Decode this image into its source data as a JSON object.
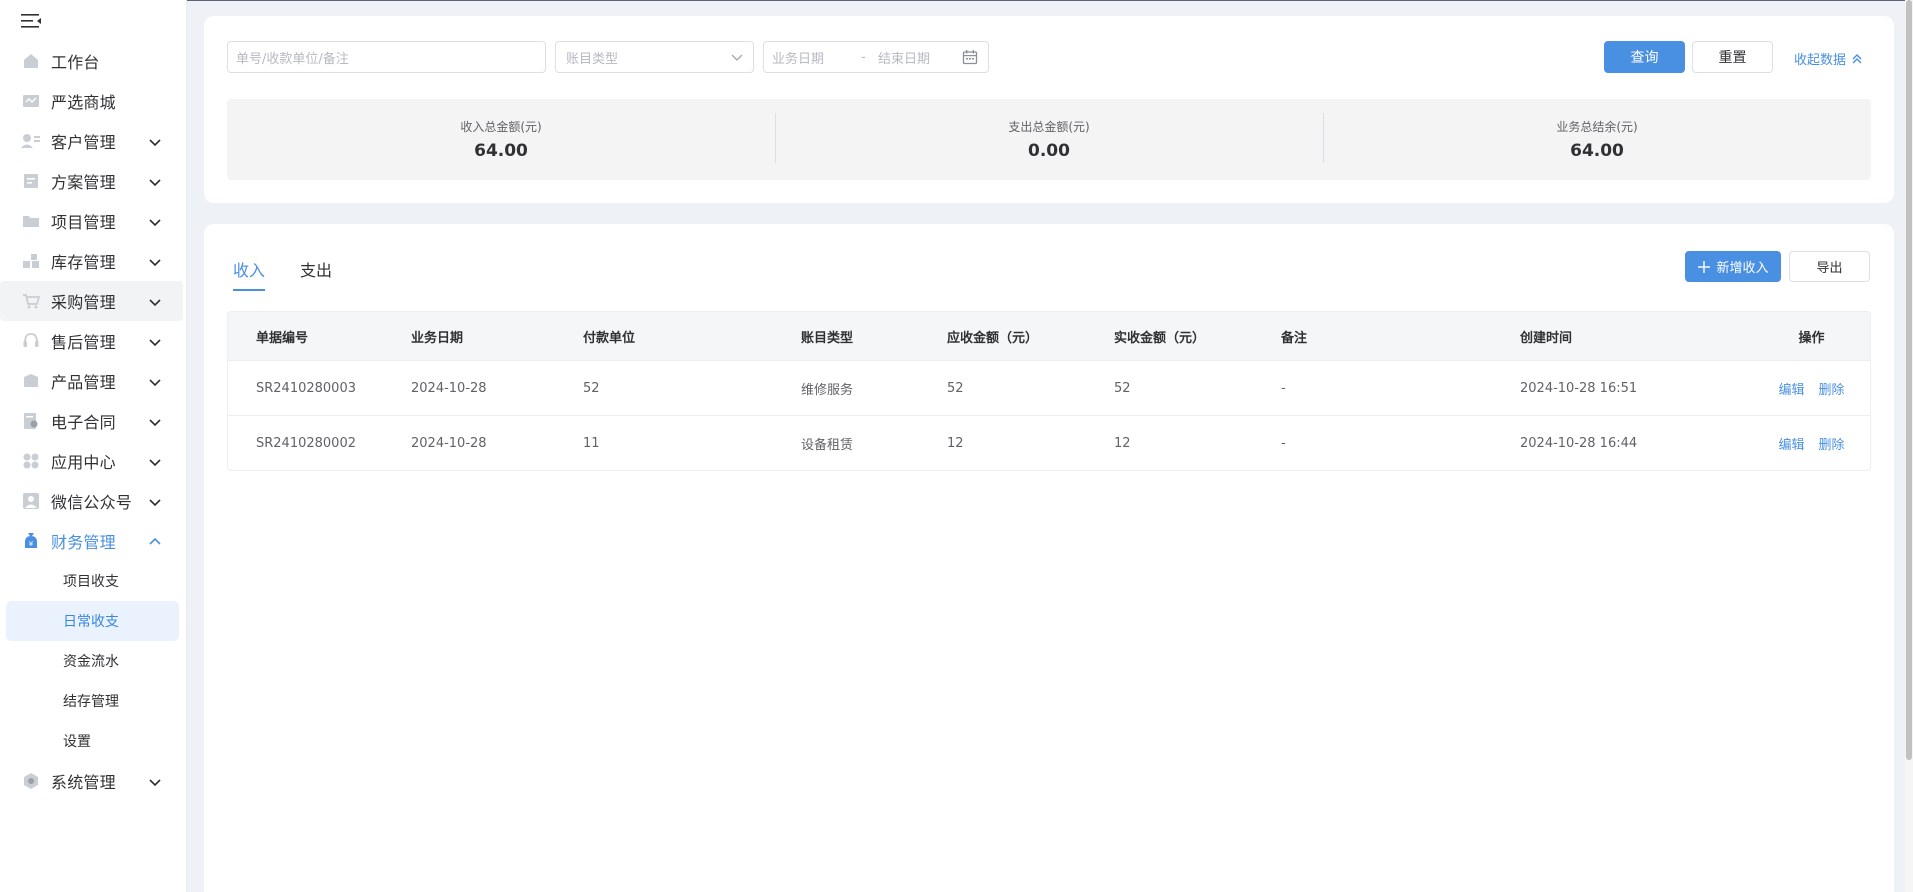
{
  "sidebar": {
    "items": [
      {
        "label": "工作台",
        "icon": "home-icon",
        "has_children": false
      },
      {
        "label": "严选商城",
        "icon": "mall-icon",
        "has_children": false
      },
      {
        "label": "客户管理",
        "icon": "customer-icon",
        "has_children": true
      },
      {
        "label": "方案管理",
        "icon": "plan-icon",
        "has_children": true
      },
      {
        "label": "项目管理",
        "icon": "folder-icon",
        "has_children": true
      },
      {
        "label": "库存管理",
        "icon": "inventory-icon",
        "has_children": true
      },
      {
        "label": "采购管理",
        "icon": "cart-icon",
        "has_children": true
      },
      {
        "label": "售后管理",
        "icon": "headset-icon",
        "has_children": true
      },
      {
        "label": "产品管理",
        "icon": "product-icon",
        "has_children": true
      },
      {
        "label": "电子合同",
        "icon": "contract-icon",
        "has_children": true
      },
      {
        "label": "应用中心",
        "icon": "apps-icon",
        "has_children": true
      },
      {
        "label": "微信公众号",
        "icon": "wechat-icon",
        "has_children": true
      },
      {
        "label": "财务管理",
        "icon": "finance-icon",
        "has_children": true,
        "expanded": true
      },
      {
        "label": "系统管理",
        "icon": "system-icon",
        "has_children": true
      }
    ],
    "finance_children": [
      "项目收支",
      "日常收支",
      "资金流水",
      "结存管理",
      "设置"
    ],
    "selected_child": "日常收支",
    "hovered_item": "采购管理"
  },
  "filters": {
    "search_placeholder": "单号/收款单位/备注",
    "type_placeholder": "账目类型",
    "start_date_placeholder": "业务日期",
    "date_separator": "-",
    "end_date_placeholder": "结束日期",
    "query_label": "查询",
    "reset_label": "重置",
    "collapse_label": "收起数据"
  },
  "summary": [
    {
      "label": "收入总金额(元)",
      "value": "64.00"
    },
    {
      "label": "支出总金额(元)",
      "value": "0.00"
    },
    {
      "label": "业务总结余(元)",
      "value": "64.00"
    }
  ],
  "tabs": [
    {
      "label": "收入",
      "active": true
    },
    {
      "label": "支出",
      "active": false
    }
  ],
  "actions": {
    "add_label": "新增收入",
    "export_label": "导出"
  },
  "table": {
    "headers": [
      "单据编号",
      "业务日期",
      "付款单位",
      "账目类型",
      "应收金额（元）",
      "实收金额（元）",
      "备注",
      "创建时间",
      "操作"
    ],
    "rows": [
      {
        "id": "SR2410280003",
        "date": "2024-10-28",
        "payer": "52",
        "type": "维修服务",
        "receivable": "52",
        "received": "52",
        "note": "-",
        "created": "2024-10-28 16:51",
        "edit": "编辑",
        "delete": "删除"
      },
      {
        "id": "SR2410280002",
        "date": "2024-10-28",
        "payer": "11",
        "type": "设备租赁",
        "receivable": "12",
        "received": "12",
        "note": "-",
        "created": "2024-10-28 16:44",
        "edit": "编辑",
        "delete": "删除"
      }
    ]
  },
  "colors": {
    "accent": "#4a90e2",
    "selected_bg": "#eaf3fd",
    "page_bg": "#eef2f6"
  }
}
